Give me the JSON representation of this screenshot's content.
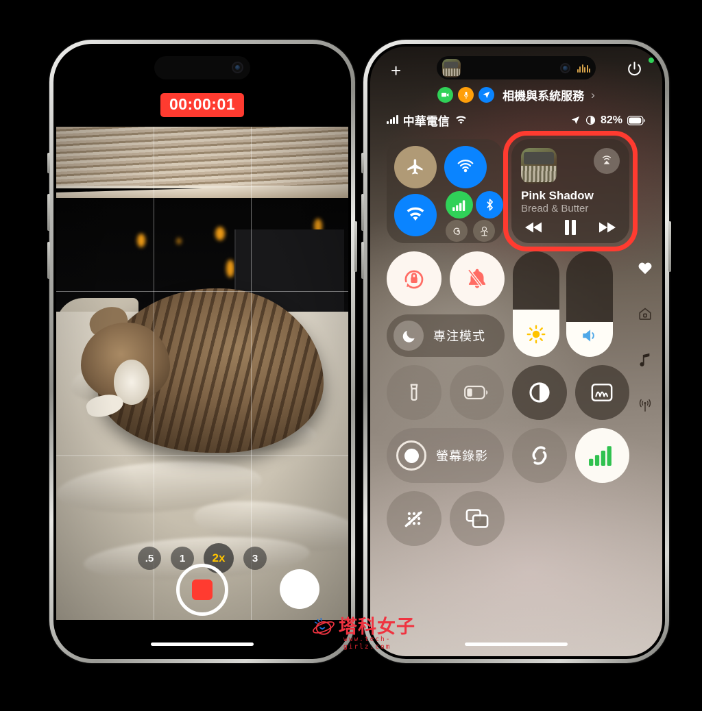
{
  "left_phone": {
    "app": "Camera",
    "recording_timer": "00:00:01",
    "zoom_options": [
      {
        "label": ".5",
        "selected": false
      },
      {
        "label": "1",
        "selected": false
      },
      {
        "label": "2x",
        "selected": true
      },
      {
        "label": "3",
        "selected": false
      }
    ],
    "selected_zoom": "2x",
    "shutter": {
      "mode": "recording",
      "stop_label": "stop-recording",
      "photo_label": "take-photo"
    },
    "scene_description": "Sleeping tabby cat on a bed beside a window with blinds",
    "grid_overlay": true,
    "colors": {
      "timer_bg": "#ff3b30",
      "zoom_selected": "#ffc400"
    }
  },
  "right_phone": {
    "app": "Control Center",
    "dynamic_island": {
      "activity": "now-playing",
      "waveform_bars": [
        5,
        9,
        12,
        8,
        11,
        6
      ]
    },
    "plus_label": "+",
    "power_label": "power",
    "privacy_banner": {
      "indicators": [
        "camera",
        "microphone",
        "location"
      ],
      "label": "相機與系統服務",
      "chevron": "›"
    },
    "status_bar": {
      "signal_bars": [
        4,
        7,
        10,
        13
      ],
      "carrier": "中華電信",
      "wifi": "wifi-icon",
      "location": "location-arrow",
      "focus": "focus-icon",
      "battery_percent": "82%"
    },
    "connectivity": {
      "airplane": {
        "name": "airplane-mode",
        "state": "off",
        "color": "#b09a76"
      },
      "airdrop": {
        "name": "airdrop",
        "state": "on",
        "color": "#0a84ff"
      },
      "wifi": {
        "name": "wifi",
        "state": "on",
        "color": "#0a84ff"
      },
      "cellular": {
        "name": "cellular-data",
        "state": "on",
        "color": "#30d158"
      },
      "bluetooth": {
        "name": "bluetooth",
        "state": "on",
        "color": "#0a84ff"
      },
      "hotspot": {
        "name": "personal-hotspot",
        "state": "off"
      },
      "satellite": {
        "name": "satellite",
        "state": "off"
      }
    },
    "media": {
      "title": "Pink Shadow",
      "artist": "Bread & Butter",
      "airplay_label": "airplay",
      "prev_label": "previous-track",
      "play_state": "pause",
      "next_label": "next-track",
      "highlighted": true,
      "highlight_color": "#ff3b30"
    },
    "rotation_lock": {
      "name": "rotation-lock",
      "state": "on"
    },
    "silent_mode": {
      "name": "silent-mode",
      "state": "on"
    },
    "focus_mode": {
      "label": "專注模式",
      "icon": "moon"
    },
    "brightness": {
      "name": "brightness-slider",
      "value_percent": 45
    },
    "volume": {
      "name": "volume-slider",
      "value_percent": 33
    },
    "rail_icons": [
      "heart",
      "home",
      "music-note",
      "connectivity"
    ],
    "tiles": [
      {
        "name": "flashlight",
        "state": "off"
      },
      {
        "name": "low-power-mode",
        "state": "off"
      },
      {
        "name": "dark-mode",
        "state": "off"
      },
      {
        "name": "notes",
        "state": "off"
      }
    ],
    "screen_record": {
      "label": "螢幕錄影",
      "name": "screen-recording"
    },
    "shazam": {
      "name": "shazam",
      "state": "off"
    },
    "cellular_tile": {
      "name": "cellular-signal",
      "state": "on"
    },
    "tiles_bottom": [
      {
        "name": "low-data-mode",
        "state": "off"
      },
      {
        "name": "stage-manager",
        "state": "off"
      }
    ]
  },
  "watermark": {
    "name": "塔科女子",
    "url": "www.tech-girlz.com",
    "color": "#ef3340"
  }
}
